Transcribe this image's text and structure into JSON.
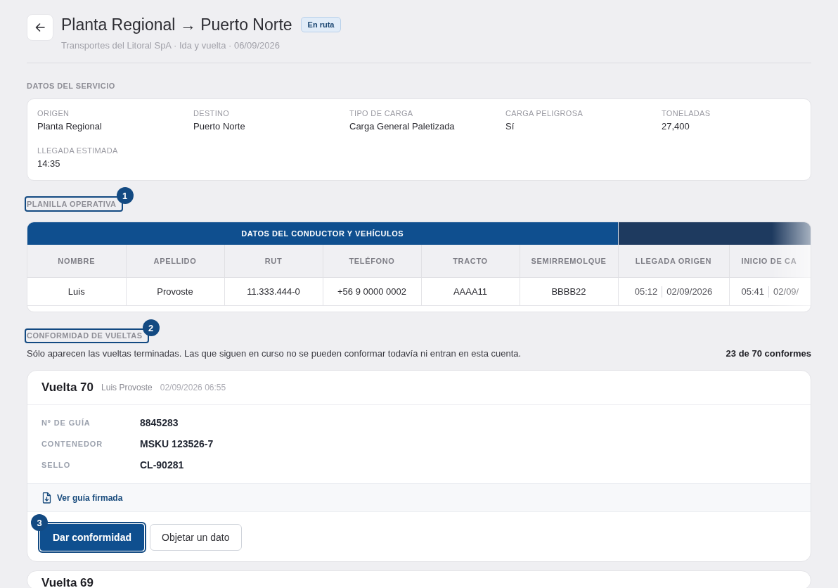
{
  "header": {
    "title": "Planta Regional → Puerto Norte",
    "status": "En ruta",
    "subtitle": "Transportes del Litoral SpA · Ida y vuelta · 06/09/2026"
  },
  "service": {
    "heading": "DATOS DEL SERVICIO",
    "fields": [
      {
        "label": "ORIGEN",
        "value": "Planta Regional"
      },
      {
        "label": "DESTINO",
        "value": "Puerto Norte"
      },
      {
        "label": "TIPO DE CARGA",
        "value": "Carga General Paletizada"
      },
      {
        "label": "CARGA PELIGROSA",
        "value": "Sí"
      },
      {
        "label": "TONELADAS",
        "value": "27,400"
      },
      {
        "label": "LLEGADA ESTIMADA",
        "value": "14:35"
      }
    ]
  },
  "planilla": {
    "heading": "PLANILLA OPERATIVA",
    "callout": "1",
    "column_groups": [
      {
        "label": "DATOS DEL CONDUCTOR Y VEHÍCULOS",
        "color": "#0f4f8f",
        "columns": [
          "NOMBRE",
          "APELLIDO",
          "RUT",
          "TELÉFONO",
          "TRACTO",
          "SEMIRREMOLQUE"
        ]
      },
      {
        "color": "#1e3a5f",
        "columns": [
          "LLEGADA ORIGEN",
          "INICIO DE CA"
        ]
      }
    ],
    "rows": [
      {
        "cells": [
          {
            "kind": "text",
            "text": "Luis"
          },
          {
            "kind": "text",
            "text": "Provoste"
          },
          {
            "kind": "text",
            "text": "11.333.444-0"
          },
          {
            "kind": "text",
            "text": "+56 9 0000 0002"
          },
          {
            "kind": "text",
            "text": "AAAA11"
          },
          {
            "kind": "text",
            "text": "BBBB22"
          },
          {
            "kind": "datetime",
            "time": "05:12",
            "date": "02/09/2026"
          },
          {
            "kind": "datetime",
            "time": "05:41",
            "date": "02/09/"
          }
        ]
      }
    ]
  },
  "conformidad": {
    "heading": "CONFORMIDAD DE VUELTAS",
    "callout": "2",
    "note": "Sólo aparecen las vueltas terminadas. Las que siguen en curso no se pueden conformar todavía ni entran en esta cuenta.",
    "count": "23 de 70 conformes",
    "trips": [
      {
        "title": "Vuelta 70",
        "driver": "Luis Provoste",
        "datetime": "02/09/2026 06:55",
        "fields": [
          {
            "label": "Nº DE GUÍA",
            "value": "8845283"
          },
          {
            "label": "CONTENEDOR",
            "value": "MSKU 123526-7"
          },
          {
            "label": "SELLO",
            "value": "CL-90281"
          }
        ],
        "document_link": "Ver guía firmada",
        "actions": [
          {
            "kind": "primary",
            "label": "Dar conformidad",
            "callout": "3"
          },
          {
            "kind": "secondary",
            "label": "Objetar un dato"
          }
        ]
      },
      {
        "title": "Vuelta 69"
      }
    ]
  }
}
